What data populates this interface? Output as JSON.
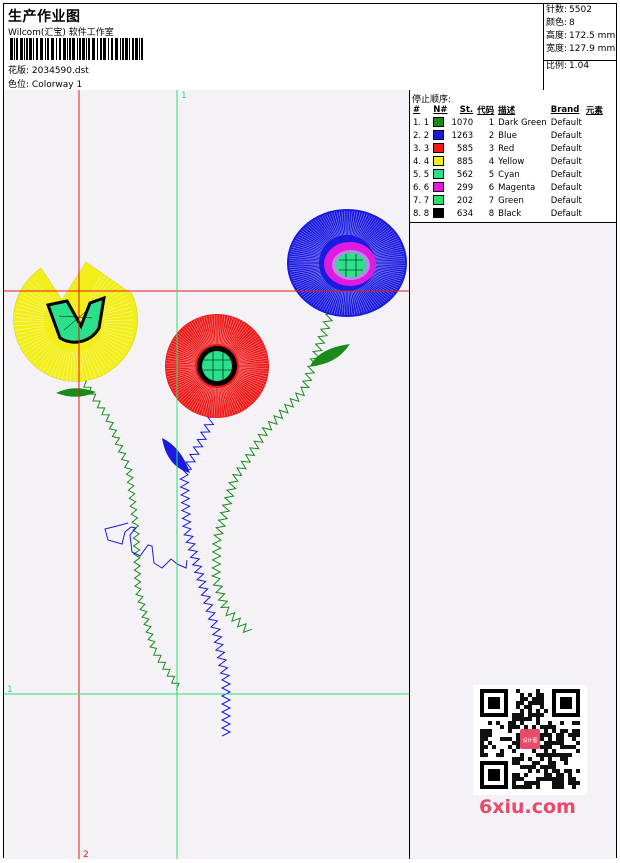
{
  "header": {
    "title": "生产作业图",
    "company": "Wilcom(汇宝) 软件工作室",
    "design_label": "花版:",
    "design_value": "2034590.dst",
    "colorway_label": "色位:",
    "colorway_value": "Colorway 1"
  },
  "stats": [
    {
      "label": "针数:",
      "value": "5502"
    },
    {
      "label": "颜色:",
      "value": "8"
    },
    {
      "label": "高度:",
      "value": "172.5 mm"
    },
    {
      "label": "宽度:",
      "value": "127.9 mm"
    },
    {
      "label": "比例:",
      "value": "1.04"
    }
  ],
  "guides": {
    "v_red": "2",
    "v_green": "1",
    "h_green": "1"
  },
  "stop_sequence": {
    "title": "停止顺序:",
    "columns": [
      "#",
      "N#",
      "St.",
      "代码",
      "描述",
      "Brand",
      "元素"
    ],
    "rows": [
      {
        "idx": "1. 1",
        "color": "#1a8a1a",
        "stitches": "1070",
        "code": "1",
        "desc": "Dark Green",
        "brand": "Default"
      },
      {
        "idx": "2. 2",
        "color": "#1a1ae0",
        "stitches": "1263",
        "code": "2",
        "desc": "Blue",
        "brand": "Default"
      },
      {
        "idx": "3. 3",
        "color": "#ee1a1a",
        "stitches": "585",
        "code": "3",
        "desc": "Red",
        "brand": "Default"
      },
      {
        "idx": "4. 4",
        "color": "#f2ee1a",
        "stitches": "885",
        "code": "4",
        "desc": "Yellow",
        "brand": "Default"
      },
      {
        "idx": "5. 5",
        "color": "#2ae08a",
        "stitches": "562",
        "code": "5",
        "desc": "Cyan",
        "brand": "Default"
      },
      {
        "idx": "6. 6",
        "color": "#e01ae0",
        "stitches": "299",
        "code": "6",
        "desc": "Magenta",
        "brand": "Default"
      },
      {
        "idx": "7. 7",
        "color": "#2ae06a",
        "stitches": "202",
        "code": "7",
        "desc": "Green",
        "brand": "Default"
      },
      {
        "idx": "8. 8",
        "color": "#000000",
        "stitches": "634",
        "code": "8",
        "desc": "Black",
        "brand": "Default"
      }
    ]
  },
  "watermark": "6xiu.com",
  "qr_badge": "设计图"
}
